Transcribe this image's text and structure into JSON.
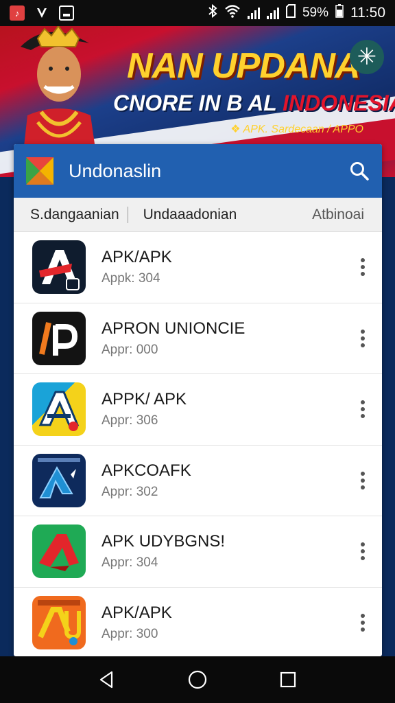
{
  "status_bar": {
    "battery": "59%",
    "time": "11:50"
  },
  "banner": {
    "title": "NAN UPDANA",
    "subtitle_white": "CNORE IN B AL ",
    "subtitle_red": "INDONESIAA",
    "tagline": "❖ APK. Sardecaan / APPO",
    "fab_symbol": "✳"
  },
  "appbar": {
    "title": "Undonaslin"
  },
  "tabs": [
    "S.dangaanian",
    "Undaaadonian",
    "Atbinoai"
  ],
  "apps": [
    {
      "name": "APK/APK",
      "version": "Appk: 304",
      "icon_bg": "#0f1c2e",
      "accent": "#e3262b"
    },
    {
      "name": "APRON UNIONCIE",
      "version": "Appr: 000",
      "icon_bg": "#131313",
      "accent": "#f07a1e"
    },
    {
      "name": "APPK/ APK",
      "version": "Appr: 306",
      "icon_bg": "#f4d21a",
      "accent": "#1aa3d8"
    },
    {
      "name": "APKCOAFK",
      "version": "Appr: 302",
      "icon_bg": "#0e2a5c",
      "accent": "#1f8fd4"
    },
    {
      "name": "APK UDYBGNS!",
      "version": "Appr: 304",
      "icon_bg": "#1faa55",
      "accent": "#e3262b"
    },
    {
      "name": "APK/APK",
      "version": "Appr: 300",
      "icon_bg": "#f06a1e",
      "accent": "#f4d21a"
    }
  ],
  "colors": {
    "appbar": "#2160b0",
    "banner_red": "#c8102e",
    "banner_blue": "#1c3f8a",
    "title_yellow": "#ffd12e"
  }
}
